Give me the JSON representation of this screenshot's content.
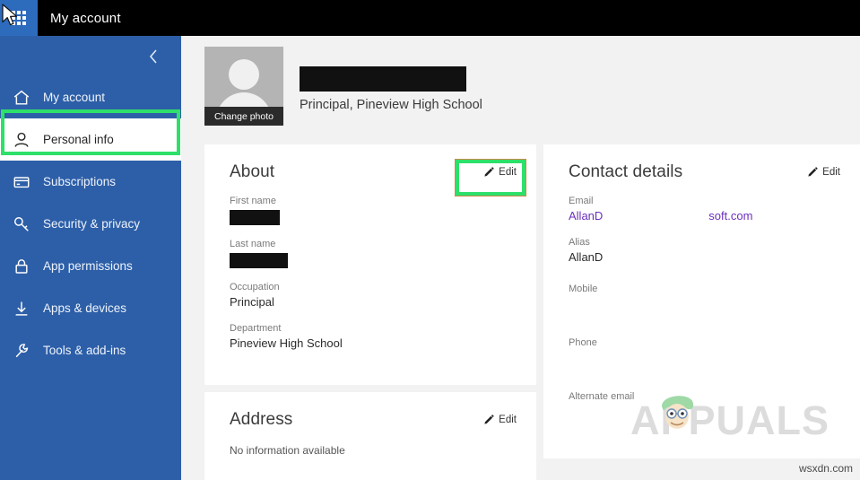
{
  "topbar": {
    "app_launcher_icon": "waffle-grid-icon",
    "title": "My account"
  },
  "sidebar": {
    "collapse_icon": "chevron-left-icon",
    "accent_color": "#2d5fa8",
    "highlight_color": "#2ee06a",
    "items": [
      {
        "label": "My account",
        "icon": "home-icon",
        "selected": false
      },
      {
        "label": "Personal info",
        "icon": "person-icon",
        "selected": true
      },
      {
        "label": "Subscriptions",
        "icon": "credit-card-icon",
        "selected": false
      },
      {
        "label": "Security & privacy",
        "icon": "key-icon",
        "selected": false
      },
      {
        "label": "App permissions",
        "icon": "lock-icon",
        "selected": false
      },
      {
        "label": "Apps & devices",
        "icon": "download-icon",
        "selected": false
      },
      {
        "label": "Tools & add-ins",
        "icon": "wrench-icon",
        "selected": false
      }
    ]
  },
  "profile": {
    "photo_caption": "Change photo",
    "avatar_icon": "person-placeholder-icon",
    "name_redacted": true,
    "role": "Principal, Pineview High School"
  },
  "about_card": {
    "title": "About",
    "edit_label": "Edit",
    "edit_icon": "pencil-icon",
    "fields": [
      {
        "label": "First name",
        "value": "",
        "redacted": true
      },
      {
        "label": "Last name",
        "value": "",
        "redacted": true
      },
      {
        "label": "Occupation",
        "value": "Principal",
        "redacted": false
      },
      {
        "label": "Department",
        "value": "Pineview High School",
        "redacted": false
      }
    ]
  },
  "address_card": {
    "title": "Address",
    "edit_label": "Edit",
    "edit_icon": "pencil-icon",
    "empty_text": "No information available"
  },
  "contact_card": {
    "title": "Contact details",
    "edit_label": "Edit",
    "edit_icon": "pencil-icon",
    "email": {
      "label": "Email",
      "value_left": "AllanD",
      "value_right": "soft.com"
    },
    "fields": [
      {
        "label": "Alias",
        "value": "AllanD"
      },
      {
        "label": "Mobile",
        "value": ""
      },
      {
        "label": "Phone",
        "value": ""
      },
      {
        "label": "Alternate email",
        "value": ""
      }
    ]
  },
  "watermark": {
    "text": "APPUALS",
    "face_icon": "cartoon-face-icon"
  },
  "corner_note": "wsxdn.com"
}
